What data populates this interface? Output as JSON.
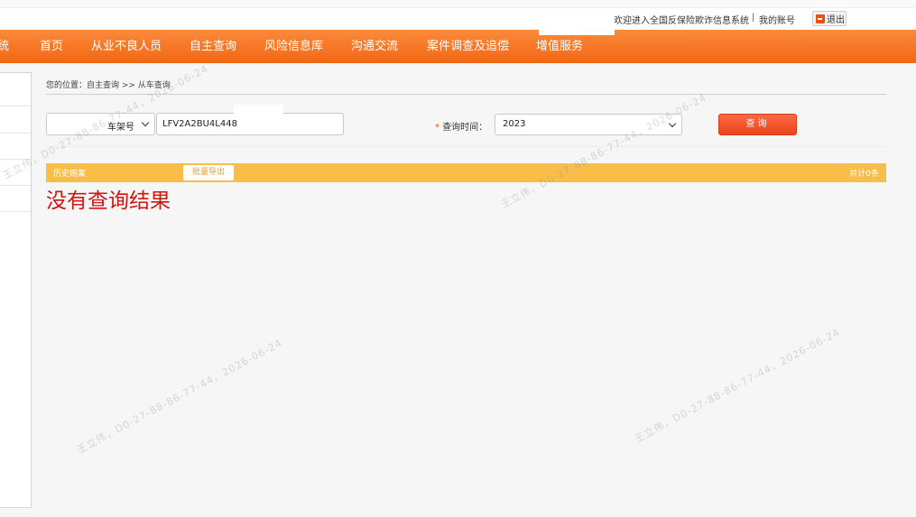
{
  "header": {
    "welcome_text": "欢迎进入全国反保险欺诈信息系统",
    "separator": "|",
    "my_account": "我的账号",
    "logout": "退出"
  },
  "nav": {
    "items": [
      {
        "label": "统"
      },
      {
        "label": "首页"
      },
      {
        "label": "从业不良人员"
      },
      {
        "label": "自主查询"
      },
      {
        "label": "风险信息库"
      },
      {
        "label": "沟通交流"
      },
      {
        "label": "案件调查及追偿"
      },
      {
        "label": "增值服务"
      }
    ]
  },
  "breadcrumb": "您的位置：自主查询 >> 从车查询",
  "search": {
    "field_type": "车架号",
    "vin_value": "LFV2A2BU4L448",
    "time_label": "查询时间：",
    "required_mark": "*",
    "time_value": "2023",
    "query_button": "查询"
  },
  "results": {
    "section_title": "历史赔案",
    "export_button": "批量导出",
    "total": "共计0条",
    "empty_message": "没有查询结果"
  },
  "watermark": "王立伟，D0-27-88-86-77-44，2026-06-24",
  "colors": {
    "nav_orange": "#f26714",
    "result_bar": "#f9bd48",
    "query_button": "#e9451b",
    "empty_message": "#d11414"
  }
}
